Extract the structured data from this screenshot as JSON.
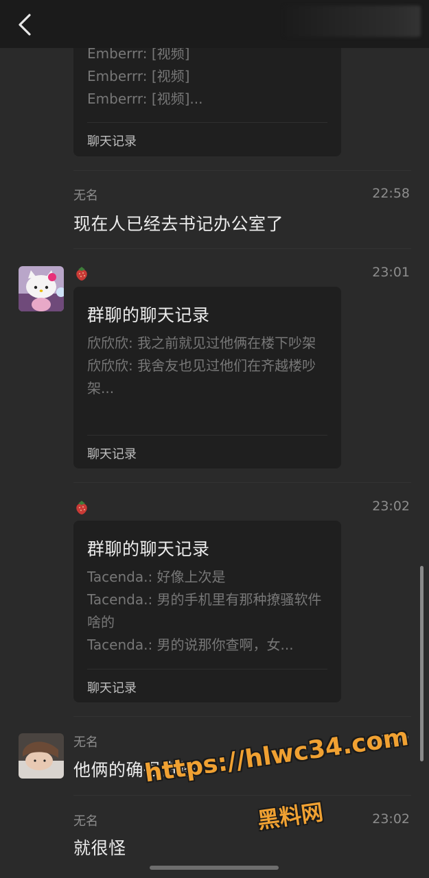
{
  "top_card": {
    "lines": [
      "Emberrr: [视频]",
      "Emberrr: [视频]",
      "Emberrr: [视频]..."
    ],
    "footer": "聊天记录"
  },
  "messages": [
    {
      "sender": "无名",
      "time": "22:58",
      "text": "现在人已经去书记办公室了"
    },
    {
      "sender": "🍓",
      "time": "23:01",
      "card": {
        "title": "群聊的聊天记录",
        "lines": [
          "欣欣欣: 我之前就见过他俩在楼下吵架",
          "欣欣欣: 我舍友也见过他们在齐越楼吵架..."
        ],
        "footer": "聊天记录"
      }
    },
    {
      "sender": "🍓",
      "time": "23:02",
      "card": {
        "title": "群聊的聊天记录",
        "lines": [
          "Tacenda.: 好像上次是",
          "Tacenda.: 男的手机里有那种撩骚软件啥的",
          "Tacenda.: 男的说那你查啊，女..."
        ],
        "footer": "聊天记录"
      }
    },
    {
      "sender": "无名",
      "time": "23:02",
      "text": "他俩的确很奇怪"
    },
    {
      "sender": "无名",
      "time": "23:02",
      "text": "就很怪"
    }
  ],
  "watermark": {
    "url": "https://hlwc34.com",
    "name": "黑料网"
  },
  "colors": {
    "background": "#2a2a2a",
    "card": "#1f1f1f",
    "watermark": "#f0a132"
  }
}
